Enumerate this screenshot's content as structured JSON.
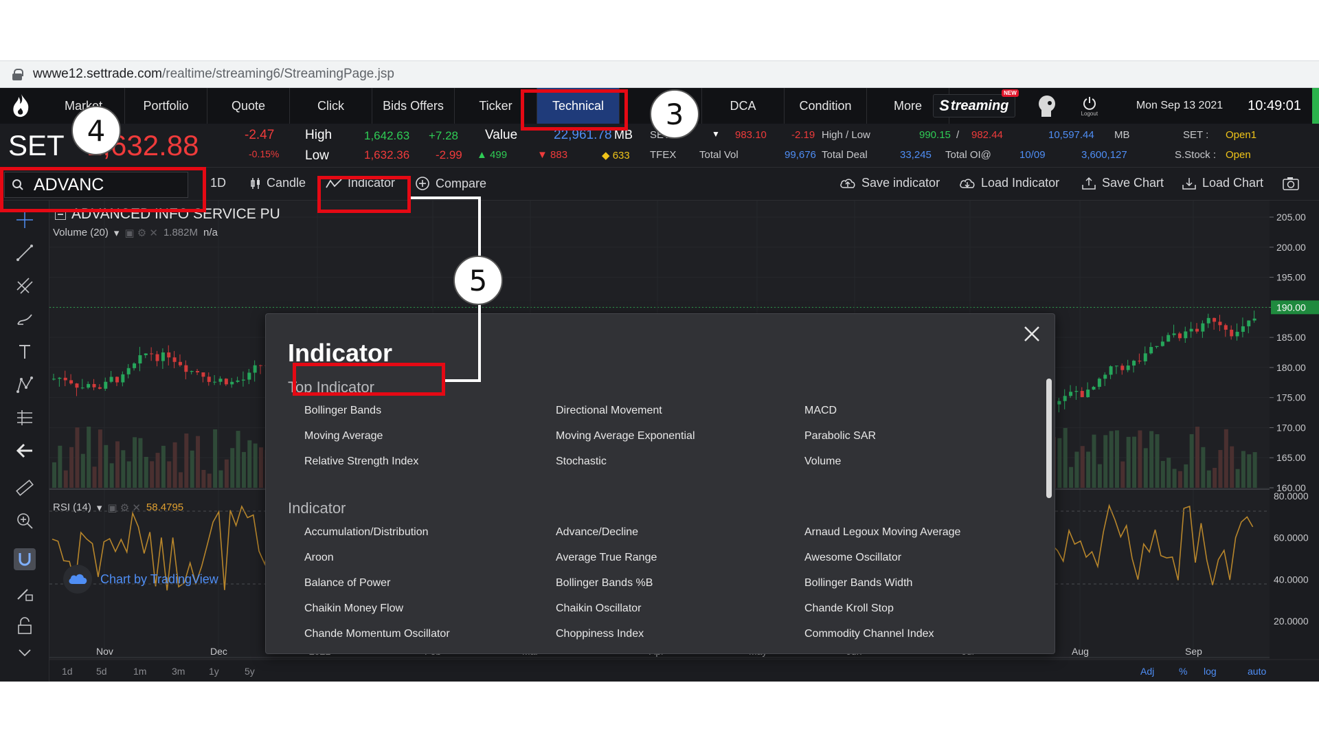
{
  "browser": {
    "url_host": "wwwe12.settrade.com",
    "url_path": "/realtime/streaming6/StreamingPage.jsp"
  },
  "nav": {
    "items": [
      "Market",
      "Portfolio",
      "Quote",
      "Click",
      "Bids Offers",
      "Ticker",
      "Technical",
      "I",
      "DCA",
      "Condition",
      "More"
    ],
    "active": "Technical",
    "streaming_logo": "treaming",
    "streaming_badge": "NEW",
    "logout": "Logout",
    "date": "Mon Sep 13 2021",
    "time": "10:49:01"
  },
  "market": {
    "index_name": "SET",
    "index_value": "1,632.88",
    "change": "-2.47",
    "change_pct": "-0.15%",
    "high_label": "High",
    "low_label": "Low",
    "high_value": "1,642.63",
    "high_change": "+7.28",
    "low_value": "1,632.36",
    "low_change": "-2.99",
    "value_label": "Value",
    "value_amount": "22,961.78",
    "value_unit": "MB",
    "up_count": "499",
    "down_count": "883",
    "unchanged_count": "633",
    "set50_label": "SET50",
    "set50_value": "983.10",
    "set50_change": "-2.19",
    "hl_label": "High / Low",
    "hl_high": "990.15",
    "hl_sep": "/",
    "hl_low": "982.44",
    "set50_value_mb": "10,597.44",
    "set50_unit": "MB",
    "set_status_label": "SET :",
    "set_status": "Open1",
    "tfex_label": "TFEX",
    "total_vol_label": "Total Vol",
    "total_vol": "99,676",
    "total_deal_label": "Total Deal",
    "total_deal": "33,245",
    "total_oi_label": "Total OI@",
    "total_oi_date": "10/09",
    "total_oi": "3,600,127",
    "sstock_label": "S.Stock :",
    "sstock_status": "Open"
  },
  "toolbar": {
    "symbol": "ADVANC",
    "interval": "1D",
    "candle": "Candle",
    "indicator": "Indicator",
    "compare": "Compare",
    "save_indicator": "Save indicator",
    "load_indicator": "Load Indicator",
    "save_chart": "Save Chart",
    "load_chart": "Load Chart"
  },
  "chart": {
    "title": "ADVANCED INFO SERVICE PU",
    "volume_label": "Volume (20)",
    "volume_value": "1.882M",
    "volume_na": "n/a",
    "rsi_label": "RSI (14)",
    "rsi_value": "58.4795",
    "credit": "Chart by TradingView",
    "price_axis": [
      "205.00",
      "200.00",
      "195.00",
      "190.00",
      "185.00",
      "180.00",
      "175.00",
      "170.00",
      "165.00",
      "160.00"
    ],
    "current_price": "190.00",
    "rsi_axis": [
      "80.0000",
      "60.0000",
      "40.0000",
      "20.0000"
    ],
    "time_axis": [
      "Nov",
      "Dec",
      "2021",
      "Feb",
      "Mar",
      "Apr",
      "May",
      "Jun",
      "Jul",
      "Aug",
      "Sep"
    ],
    "ranges": [
      "1d",
      "5d",
      "1m",
      "3m",
      "1y",
      "5y"
    ],
    "bottom_right": [
      "Adj",
      "%",
      "log",
      "auto"
    ]
  },
  "modal": {
    "title": "Indicator",
    "top_section": "Top Indicator",
    "top_items": [
      "Bollinger Bands",
      "Directional Movement",
      "MACD",
      "Moving Average",
      "Moving Average Exponential",
      "Parabolic SAR",
      "Relative Strength Index",
      "Stochastic",
      "Volume"
    ],
    "section": "Indicator",
    "items": [
      "Accumulation/Distribution",
      "Advance/Decline",
      "Arnaud Legoux Moving Average",
      "Aroon",
      "Average True Range",
      "Awesome Oscillator",
      "Balance of Power",
      "Bollinger Bands %B",
      "Bollinger Bands Width",
      "Chaikin Money Flow",
      "Chaikin Oscillator",
      "Chande Kroll Stop",
      "Chande Momentum Oscillator",
      "Choppiness Index",
      "Commodity Channel Index"
    ]
  },
  "annotations": {
    "step3": "3",
    "step4": "4",
    "step5": "5"
  },
  "colors": {
    "accent_red": "#e50914",
    "nav_active": "#1f3b7a",
    "up": "#2fcc55",
    "down": "#ef3b3b"
  }
}
